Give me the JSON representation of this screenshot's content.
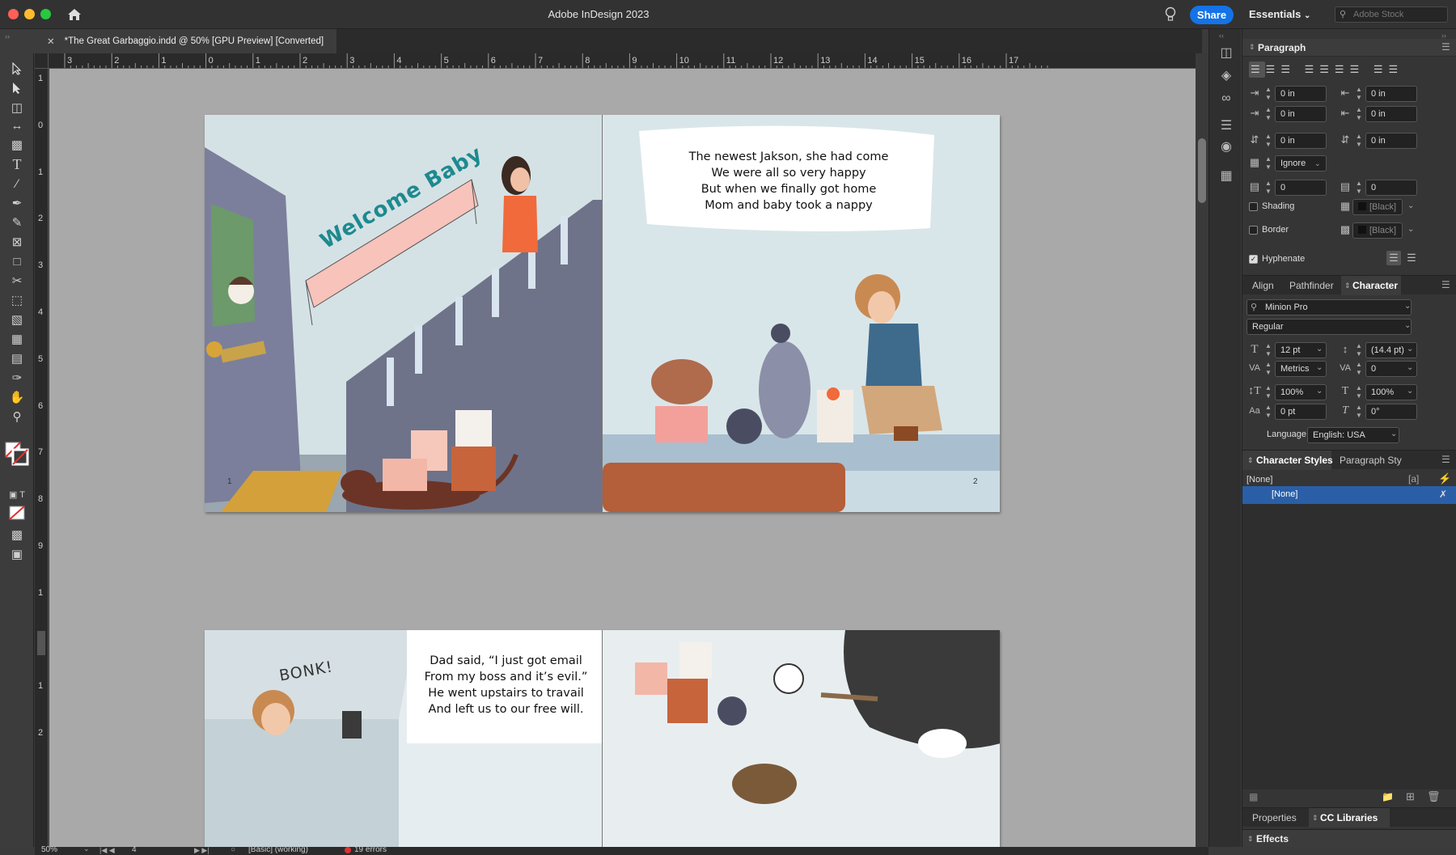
{
  "app": {
    "title": "Adobe InDesign 2023",
    "share_label": "Share",
    "workspace": "Essentials",
    "search_placeholder": "Adobe Stock"
  },
  "document": {
    "tab_title": "*The Great Garbaggio.indd @ 50% [GPU Preview] [Converted]"
  },
  "ruler": {
    "horizontal": [
      "3",
      "2",
      "1",
      "0",
      "1",
      "2",
      "3",
      "4",
      "5",
      "6",
      "7",
      "8",
      "9",
      "10",
      "11",
      "12",
      "13",
      "14",
      "15",
      "16",
      "17"
    ],
    "vertical": [
      "1",
      "0",
      "1",
      "2",
      "3",
      "4",
      "5",
      "6",
      "7",
      "8",
      "9",
      "1",
      "0",
      "1",
      "2"
    ]
  },
  "spread1": {
    "banner": "Welcome Baby",
    "verse": [
      "The newest Jakson, she had come",
      "We were all so very happy",
      "But when we finally got home",
      "Mom and baby took a nappy"
    ],
    "page_left": "1",
    "page_right": "2"
  },
  "spread2": {
    "sound": "BONK!",
    "verse": [
      "Dad said, “I just got email",
      "From my boss and it’s evil.”",
      "He went upstairs to travail",
      "And left us to our free will."
    ]
  },
  "paragraph_panel": {
    "title": "Paragraph",
    "left_indent": "0 in",
    "right_indent": "0 in",
    "first_line_indent": "0 in",
    "last_line_indent": "0 in",
    "space_before": "0 in",
    "space_after": "0 in",
    "grid_align": "Ignore",
    "drop_cap_lines": "0",
    "drop_cap_chars": "0",
    "shading_label": "Shading",
    "border_label": "Border",
    "swatch_label": "[Black]",
    "hyphenate_label": "Hyphenate",
    "shading_checked": false,
    "border_checked": false,
    "hyphenate_checked": true
  },
  "character_panel": {
    "tabs": [
      "Align",
      "Pathfinder",
      "Character"
    ],
    "font": "Minion Pro",
    "style": "Regular",
    "size": "12 pt",
    "leading": "(14.4 pt)",
    "kerning": "Metrics",
    "tracking": "0",
    "vertical_scale": "100%",
    "horizontal_scale": "100%",
    "baseline_shift": "0 pt",
    "skew": "0°",
    "language_label": "Language:",
    "language": "English: USA"
  },
  "styles_panel": {
    "tabs": [
      "Character Styles",
      "Paragraph Sty"
    ],
    "header": "[None]",
    "items": [
      "[None]"
    ]
  },
  "bottom_tabs": [
    "Properties",
    "CC Libraries"
  ],
  "effects_label": "Effects",
  "status": {
    "zoom": "50%",
    "page": "4",
    "style": "[Basic] (working)",
    "errors": "19 errors"
  },
  "colors": {
    "accent": "#1473e6",
    "error": "#e03030",
    "pasteboard": "#a9a9a9"
  }
}
